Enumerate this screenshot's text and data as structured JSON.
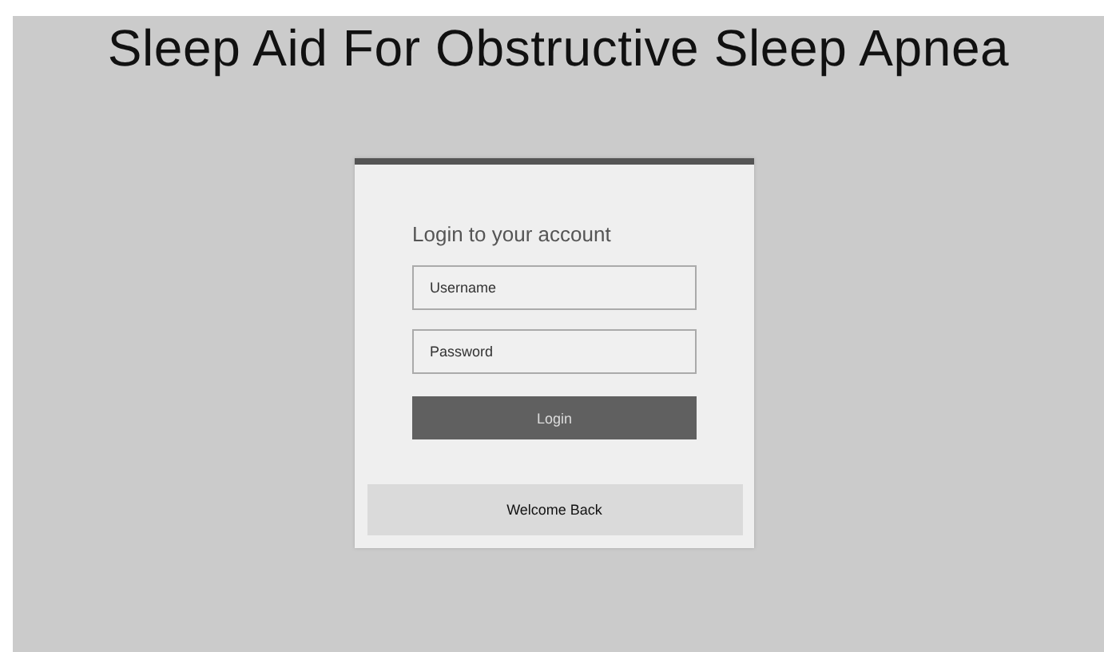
{
  "title": "Sleep Aid For Obstructive Sleep Apnea",
  "login": {
    "heading": "Login to your account",
    "username": {
      "placeholder": "Username"
    },
    "password": {
      "placeholder": "Password"
    },
    "button": "Login",
    "footer": "Welcome Back"
  }
}
